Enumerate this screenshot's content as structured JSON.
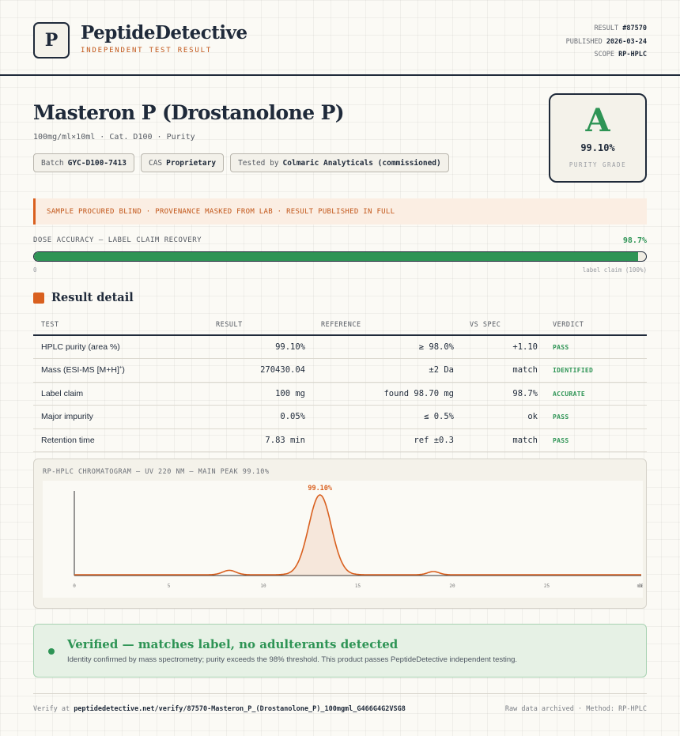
{
  "header": {
    "logo_letter": "P",
    "brand_name": "PeptideDetective",
    "brand_sub": "INDEPENDENT TEST RESULT",
    "meta": {
      "result_label": "RESULT",
      "result_value": "#87570",
      "published_label": "PUBLISHED",
      "published_value": "2026-03-24",
      "scope_label": "SCOPE",
      "scope_value": "RP-HPLC"
    }
  },
  "product": {
    "title": "Masteron P (Drostanolone P)",
    "subtitle": "100mg/ml×10ml · Cat. D100 · Purity",
    "tags": {
      "batch_label": "Batch",
      "batch_value": "GYC-D100-7413",
      "cas_label": "CAS",
      "cas_value": "Proprietary",
      "tested_label": "Tested by",
      "tested_value": "Colmaric Analyticals (commissioned)"
    }
  },
  "grade": {
    "letter": "A",
    "value": "99.10%",
    "label": "PURITY GRADE",
    "color": "#2e9455"
  },
  "notice": "SAMPLE PROCURED BLIND · PROVENANCE MASKED FROM LAB · RESULT PUBLISHED IN FULL",
  "dose": {
    "label": "DOSE ACCURACY — LABEL CLAIM RECOVERY",
    "value": "98.7%",
    "fraction": 0.987,
    "min_label": "0",
    "max_label": "label claim (100%)"
  },
  "result_detail": {
    "title": "Result detail",
    "headers": {
      "test": "TEST",
      "result": "RESULT",
      "reference": "REFERENCE",
      "vs_spec": "VS SPEC",
      "verdict": "VERDICT"
    },
    "rows": [
      {
        "test": "HPLC purity (area %)",
        "result": "99.10%",
        "reference": "≥ 98.0%",
        "vs_spec": "+1.10",
        "verdict": "PASS"
      },
      {
        "test": "Mass (ESI-MS [M+H]",
        "test_sup": "+",
        "test_end": ")",
        "result": "270430.04",
        "reference": "±2 Da",
        "vs_spec": "match",
        "verdict": "IDENTIFIED"
      },
      {
        "test": "Label claim",
        "result": "100 mg",
        "reference": "found 98.70 mg",
        "vs_spec": "98.7%",
        "verdict": "ACCURATE"
      },
      {
        "test": "Major impurity",
        "result": "0.05%",
        "reference": "≤ 0.5%",
        "vs_spec": "ok",
        "verdict": "PASS"
      },
      {
        "test": "Retention time",
        "result": "7.83 min",
        "reference": "ref ±0.3",
        "vs_spec": "match",
        "verdict": "PASS"
      }
    ]
  },
  "chart_data": {
    "type": "line",
    "title": "RP-HPLC CHROMATOGRAM — UV 220 NM — MAIN PEAK 99.10%",
    "xlabel": "",
    "ylabel": "",
    "x_ticks": [
      "0",
      "5",
      "10",
      "15",
      "20",
      "25",
      "30"
    ],
    "x_unit_label": "min",
    "xlim": [
      0,
      30
    ],
    "peak_label": "99.10%",
    "peaks": [
      {
        "rt": 8.2,
        "height": 0.055,
        "width": 0.35
      },
      {
        "rt": 13.0,
        "height": 1.0,
        "width": 0.6
      },
      {
        "rt": 19.0,
        "height": 0.04,
        "width": 0.3
      }
    ],
    "baseline": 0.0,
    "color": "#d9601f"
  },
  "verified": {
    "title": "Verified — matches label, no adulterants detected",
    "text": "Identity confirmed by mass spectrometry; purity exceeds the 98% threshold. This product passes PeptideDetective independent testing."
  },
  "footer": {
    "verify_prefix": "Verify at",
    "verify_url": "peptidedetective.net/verify/87570-Masteron_P_(Drostanolone_P)_100mgml_G466G4G2VSG8",
    "right": "Raw data archived · Method: RP-HPLC"
  }
}
